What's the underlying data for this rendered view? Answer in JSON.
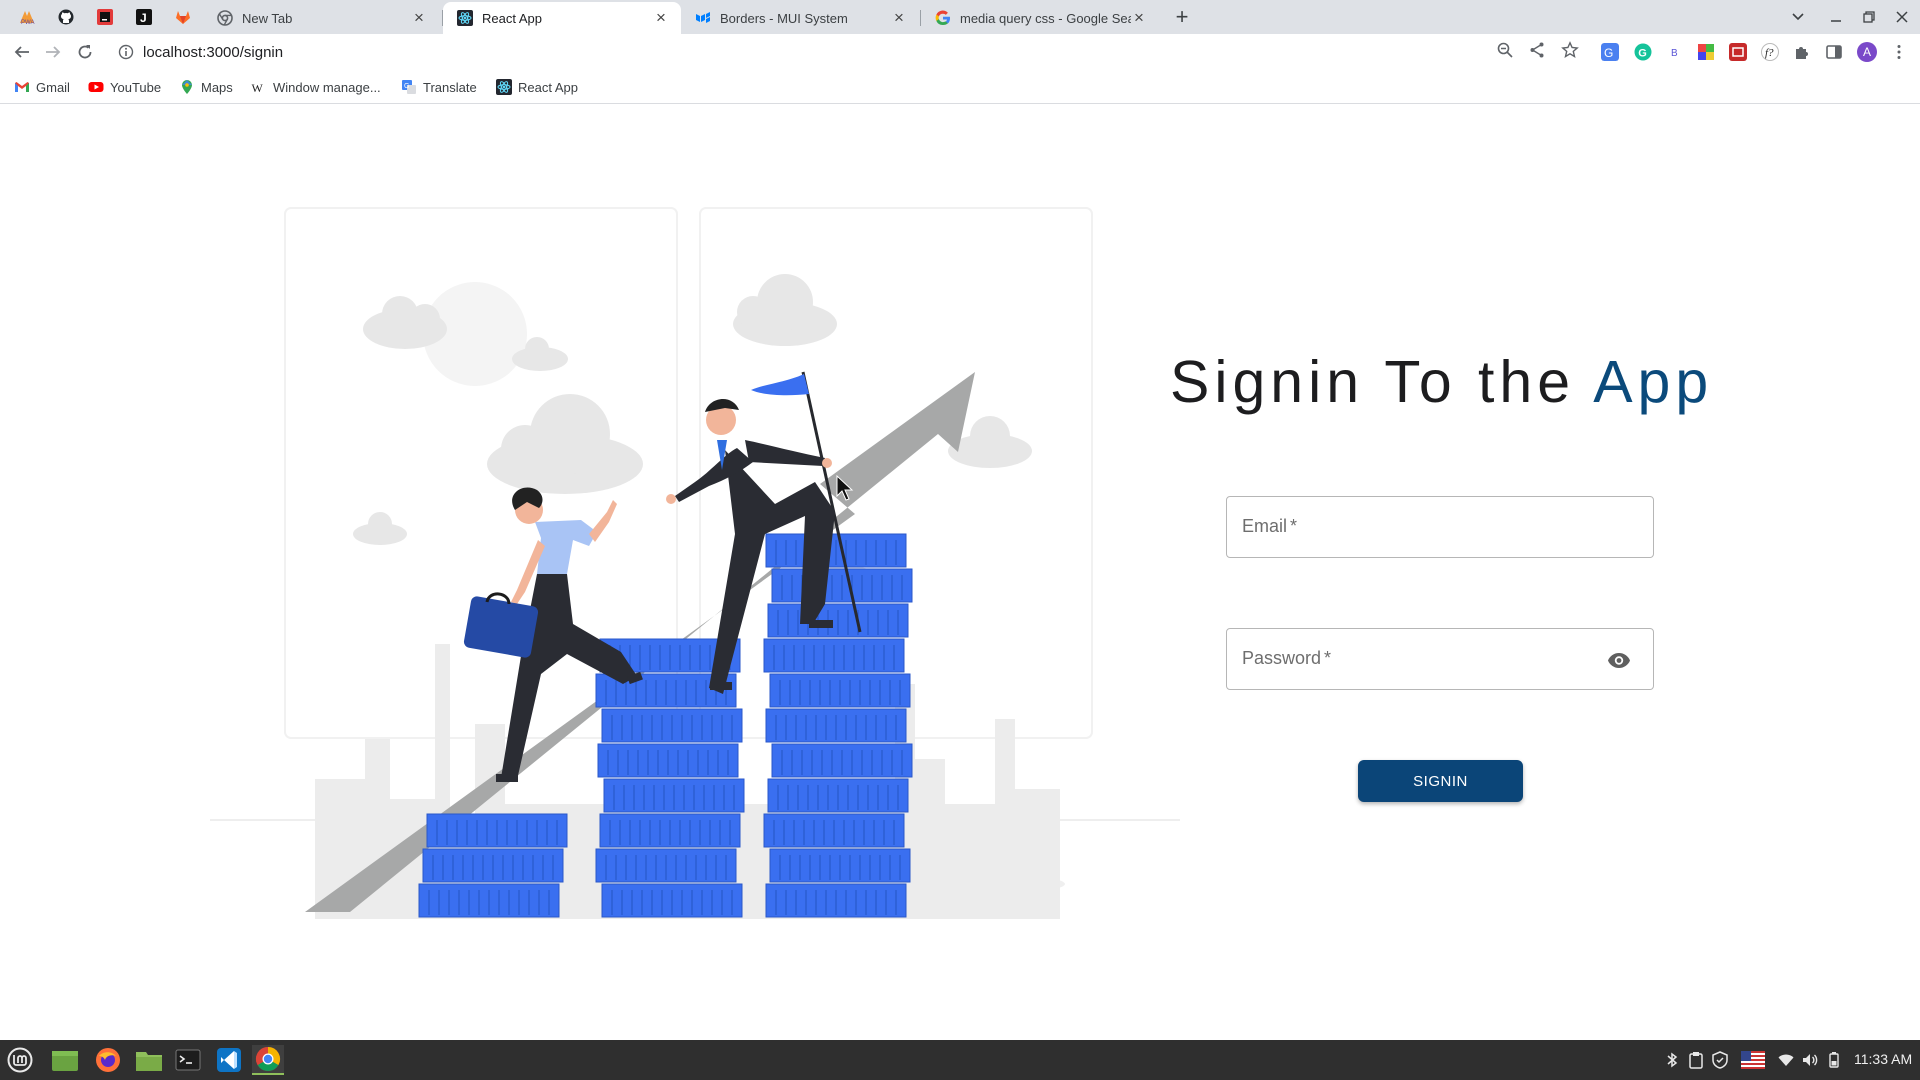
{
  "browser": {
    "tabs": [
      {
        "title": "New Tab",
        "icon": "chrome-icon"
      },
      {
        "title": "React App",
        "icon": "react-icon",
        "active": true
      },
      {
        "title": "Borders - MUI System",
        "icon": "mui-icon"
      },
      {
        "title": "media query css - Google Sea",
        "icon": "google-icon"
      }
    ],
    "pinned_tabs": [
      "pwa-icon",
      "github-icon",
      "jetbrains-icon",
      "notion-icon",
      "gitlab-icon"
    ],
    "url": "localhost:3000/signin",
    "bookmarks": [
      {
        "label": "Gmail",
        "icon": "gmail-icon"
      },
      {
        "label": "YouTube",
        "icon": "youtube-icon"
      },
      {
        "label": "Maps",
        "icon": "maps-icon"
      },
      {
        "label": "Window manage...",
        "icon": "wikipedia-icon"
      },
      {
        "label": "Translate",
        "icon": "translate-icon"
      },
      {
        "label": "React App",
        "icon": "react-icon"
      }
    ],
    "profile_initial": "A"
  },
  "page": {
    "title_main": "Signin To the ",
    "title_accent": "App",
    "email_label": "Email",
    "password_label": "Password",
    "required_mark": "*",
    "signin_button": "SIGNIN",
    "colors": {
      "accent": "#0b4a7b",
      "button": "#0b4578",
      "coins": "#3a6ff0"
    }
  },
  "taskbar": {
    "apps": [
      "mint-menu-icon",
      "files-icon",
      "firefox-icon",
      "folder-icon",
      "terminal-icon",
      "vscode-icon",
      "chrome-icon"
    ],
    "time": "11:33 AM"
  }
}
